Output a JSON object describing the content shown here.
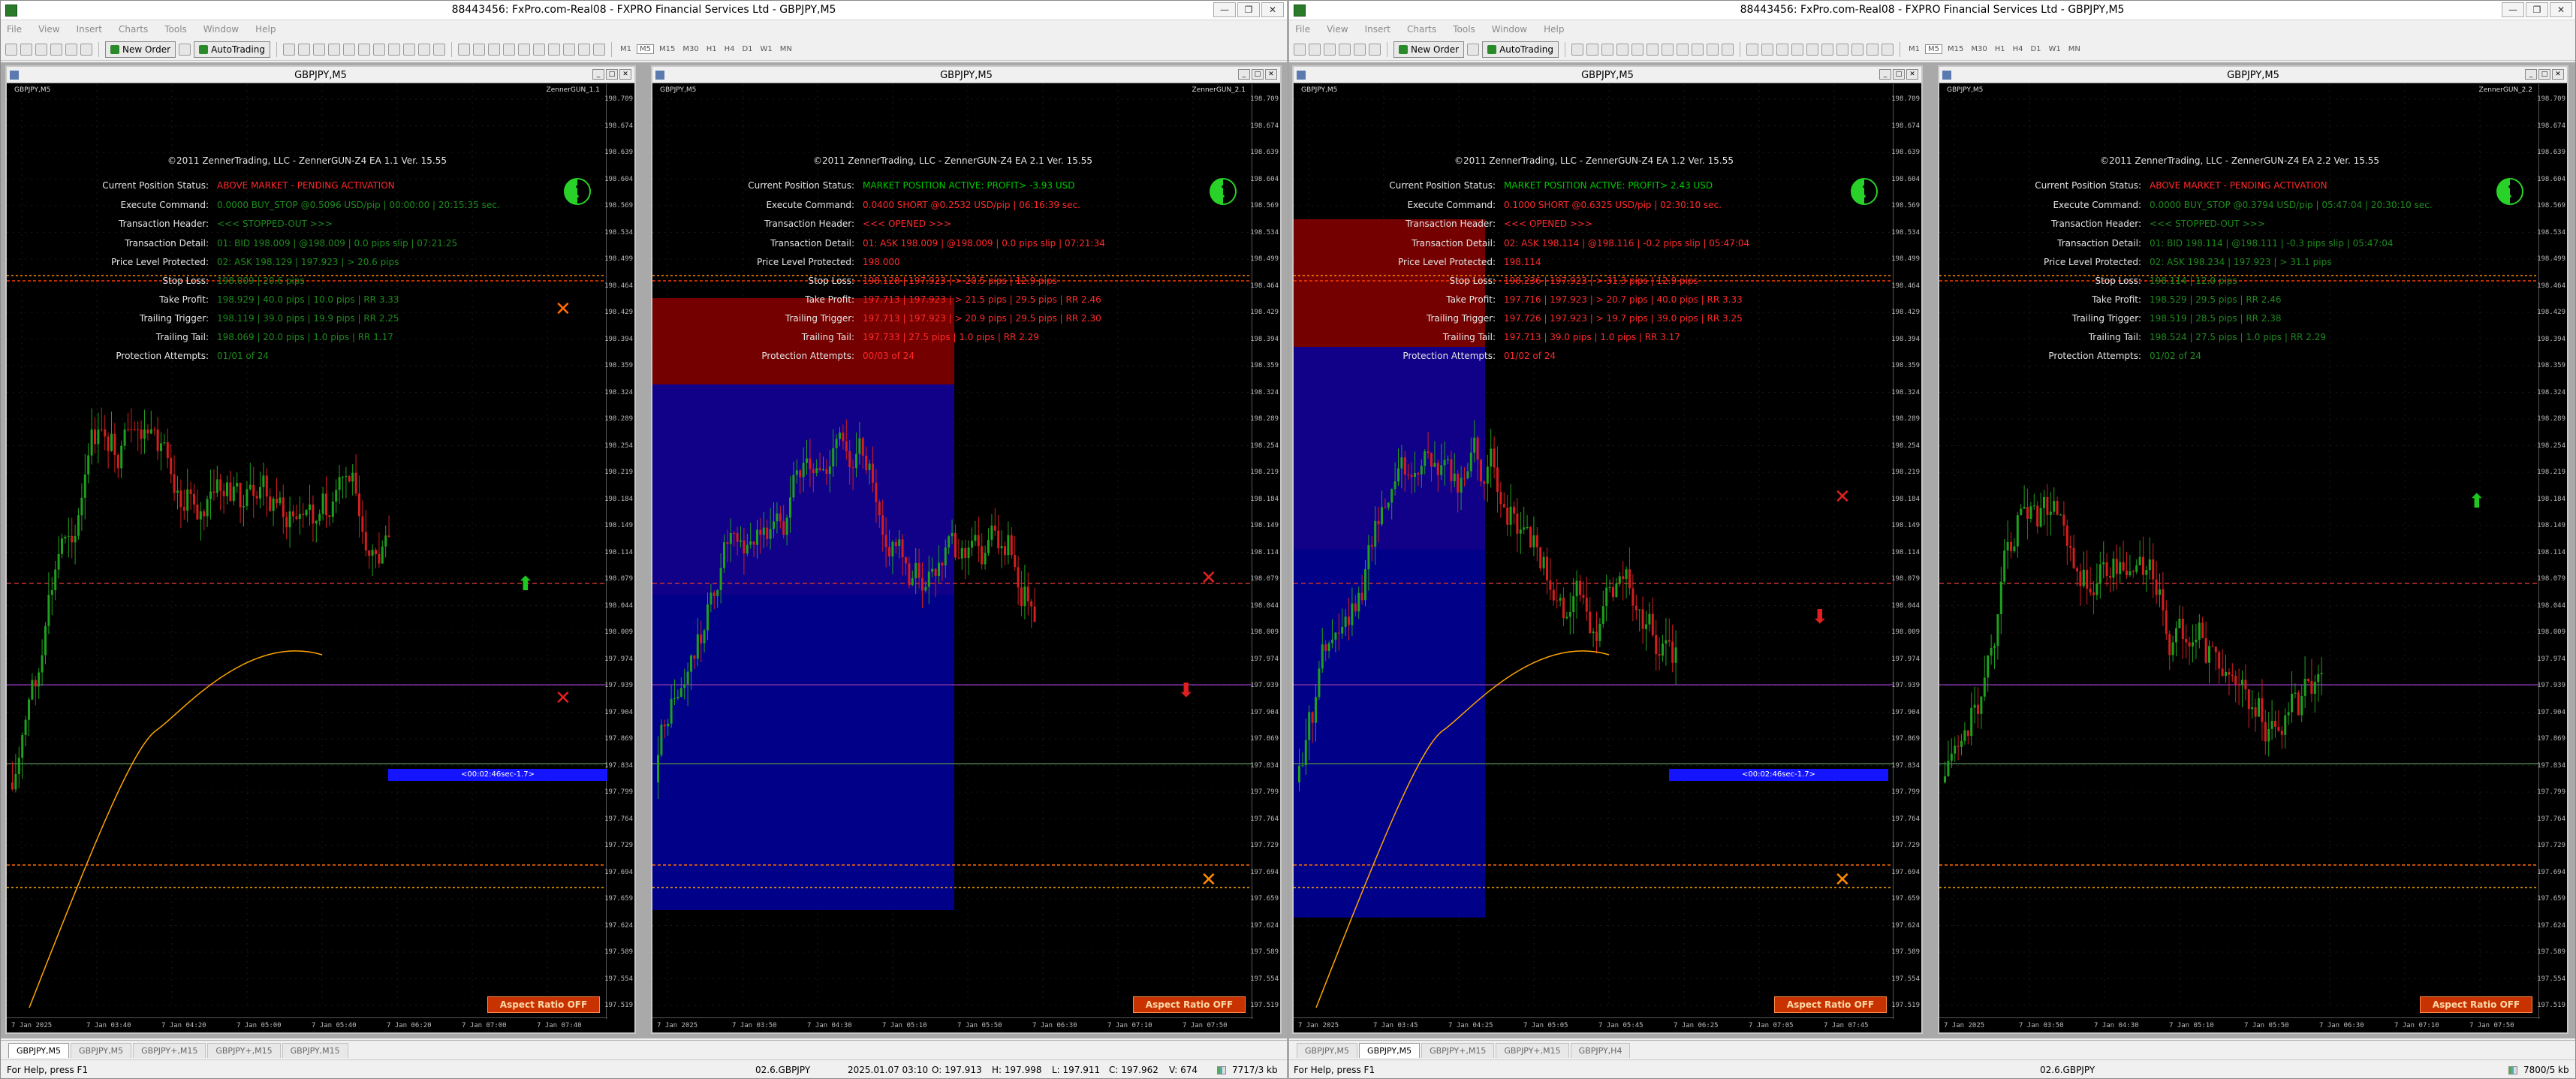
{
  "colors": {
    "label": "#e6e6e6",
    "green": "#00c800",
    "red": "#ff2a2a",
    "darkgreen": "#1e8a1e"
  },
  "windows": [
    {
      "title": "88443456: FxPro.com-Real08 - FXPRO Financial Services Ltd - GBPJPY,M5",
      "menu": [
        "File",
        "View",
        "Insert",
        "Charts",
        "Tools",
        "Window",
        "Help"
      ],
      "toolbar": {
        "new_order": "New Order",
        "auto_trading": "AutoTrading",
        "timeframes": [
          "M1",
          "M5",
          "M15",
          "M30",
          "H1",
          "H4",
          "D1",
          "W1",
          "MN"
        ],
        "active_tf": "M5"
      },
      "tabs": [
        "GBPJPY,M5",
        "GBPJPY,M5",
        "GBPJPY+,M15",
        "GBPJPY+,M15",
        "GBPJPY,M15"
      ],
      "active_tab": 0,
      "status": {
        "help": "For Help, press F1",
        "profile": "02.6.GBPJPY",
        "datetime": "2025.01.07 03:10",
        "open": "O: 197.913",
        "high": "H: 197.998",
        "low": "L: 197.911",
        "close": "C: 197.962",
        "volume": "V: 674",
        "traffic": "7717/3 kb"
      }
    },
    {
      "title": "88443456: FxPro.com-Real08 - FXPRO Financial Services Ltd - GBPJPY,M5",
      "menu": [
        "File",
        "View",
        "Insert",
        "Charts",
        "Tools",
        "Window",
        "Help"
      ],
      "toolbar": {
        "new_order": "New Order",
        "auto_trading": "AutoTrading",
        "timeframes": [
          "M1",
          "M5",
          "M15",
          "M30",
          "H1",
          "H4",
          "D1",
          "W1",
          "MN"
        ],
        "active_tf": "M5"
      },
      "tabs": [
        "GBPJPY,M5",
        "GBPJPY,M5",
        "GBPJPY+,M15",
        "GBPJPY+,M15",
        "GBPJPY,H4"
      ],
      "active_tab": 1,
      "status": {
        "help": "For Help, press F1",
        "profile": "02.6.GBPJPY",
        "traffic": "7800/5 kb"
      }
    }
  ],
  "charts": [
    {
      "title": "GBPJPY,M5",
      "symbol_tag": "GBPJPY,M5",
      "ea_tag": "ZennerGUN_1.1",
      "header": "©2011 ZennerTrading, LLC - ZennerGUN-Z4 EA 1.1 Ver. 15.55",
      "rows": [
        {
          "label": "Current Position Status:",
          "value": "ABOVE MARKET - PENDING ACTIVATION",
          "color": "#ff2a2a"
        },
        {
          "label": "Execute Command:",
          "value": "0.0000 BUY_STOP @0.5096 USD/pip | 00:00:00 | 20:15:35 sec.",
          "color": "#1e8a1e"
        },
        {
          "label": "Transaction Header:",
          "value": "<<< STOPPED-OUT >>>",
          "color": "#1e8a1e"
        },
        {
          "label": "Transaction Detail:",
          "value": "01: BID 198.009 | @198.009 | 0.0 pips slip | 07:21:25",
          "color": "#1e8a1e"
        },
        {
          "label": "Price Level Protected:",
          "value": "02: ASK 198.129 | 197.923 | > 20.6 pips",
          "color": "#1e8a1e"
        },
        {
          "label": "Stop Loss:",
          "value": "198.009 | 20.6 pips",
          "color": "#1e8a1e"
        },
        {
          "label": "Take Profit:",
          "value": "198.929 | 40.0 pips | 10.0 pips | RR 3.33",
          "color": "#1e8a1e"
        },
        {
          "label": "Trailing Trigger:",
          "value": "198.119 | 39.0 pips | 19.9 pips | RR 2.25",
          "color": "#1e8a1e"
        },
        {
          "label": "Trailing Tail:",
          "value": "198.069 | 20.0 pips | 1.0 pips | RR 1.17",
          "color": "#1e8a1e"
        },
        {
          "label": "Protection Attempts:",
          "value": "01/01 of 24",
          "color": "#1e8a1e"
        }
      ],
      "prices": [
        "198.709",
        "198.674",
        "198.639",
        "198.604",
        "198.569",
        "198.534",
        "198.499",
        "198.464",
        "198.429",
        "198.394",
        "198.359",
        "198.324",
        "198.289",
        "198.254",
        "198.219",
        "198.184",
        "198.149",
        "198.114",
        "198.079",
        "198.044",
        "198.009",
        "197.974",
        "197.939",
        "197.904",
        "197.869",
        "197.834",
        "197.799",
        "197.764",
        "197.729",
        "197.694",
        "197.659",
        "197.624",
        "197.589",
        "197.554",
        "197.519"
      ],
      "times": [
        "7 Jan 2025",
        "7 Jan 03:40",
        "7 Jan 04:20",
        "7 Jan 05:00",
        "7 Jan 05:40",
        "7 Jan 06:20",
        "7 Jan 07:00",
        "7 Jan 07:40"
      ],
      "countdown": "<00:02:46sec-1.7>",
      "aspect": "Aspect Ratio OFF"
    },
    {
      "title": "GBPJPY,M5",
      "symbol_tag": "GBPJPY,M5",
      "ea_tag": "ZennerGUN_2.1",
      "header": "©2011 ZennerTrading, LLC - ZennerGUN-Z4 EA 2.1 Ver. 15.55",
      "rows": [
        {
          "label": "Current Position Status:",
          "value": "MARKET POSITION ACTIVE: PROFIT> -3.93 USD",
          "color": "#00c800"
        },
        {
          "label": "Execute Command:",
          "value": "0.0400 SHORT @0.2532 USD/pip | 06:16:39 sec.",
          "color": "#ff2a2a"
        },
        {
          "label": "Transaction Header:",
          "value": "<<< OPENED >>>",
          "color": "#ff2a2a"
        },
        {
          "label": "Transaction Detail:",
          "value": "01: ASK 198.009 | @198.009 | 0.0 pips slip | 07:21:34",
          "color": "#ff2a2a"
        },
        {
          "label": "Price Level Protected:",
          "value": "198.000",
          "color": "#ff2a2a"
        },
        {
          "label": "Stop Loss:",
          "value": "198.128 | 197.923 | > 20.5 pips | 12.9 pips",
          "color": "#ff2a2a"
        },
        {
          "label": "Take Profit:",
          "value": "197.713 | 197.923 | > 21.5 pips | 29.5 pips | RR 2.46",
          "color": "#ff2a2a"
        },
        {
          "label": "Trailing Trigger:",
          "value": "197.713 | 197.923 | > 20.9 pips | 29.5 pips | RR 2.30",
          "color": "#ff2a2a"
        },
        {
          "label": "Trailing Tail:",
          "value": "197.733 | 27.5 pips | 1.0 pips | RR 2.29",
          "color": "#ff2a2a"
        },
        {
          "label": "Protection Attempts:",
          "value": "00/03 of 24",
          "color": "#ff2a2a"
        }
      ],
      "prices": [
        "198.709",
        "198.674",
        "198.639",
        "198.604",
        "198.569",
        "198.534",
        "198.499",
        "198.464",
        "198.429",
        "198.394",
        "198.359",
        "198.324",
        "198.289",
        "198.254",
        "198.219",
        "198.184",
        "198.149",
        "198.114",
        "198.079",
        "198.044",
        "198.009",
        "197.974",
        "197.939",
        "197.904",
        "197.869",
        "197.834",
        "197.799",
        "197.764",
        "197.729",
        "197.694",
        "197.659",
        "197.624",
        "197.589",
        "197.554",
        "197.519"
      ],
      "times": [
        "7 Jan 2025",
        "7 Jan 03:50",
        "7 Jan 04:30",
        "7 Jan 05:10",
        "7 Jan 05:50",
        "7 Jan 06:30",
        "7 Jan 07:10",
        "7 Jan 07:50"
      ],
      "countdown": "",
      "aspect": "Aspect Ratio OFF"
    },
    {
      "title": "GBPJPY,M5",
      "symbol_tag": "GBPJPY,M5",
      "ea_tag": "",
      "header": "©2011 ZennerTrading, LLC - ZennerGUN-Z4 EA 1.2 Ver. 15.55",
      "rows": [
        {
          "label": "Current Position Status:",
          "value": "MARKET POSITION ACTIVE: PROFIT> 2.43 USD",
          "color": "#00c800"
        },
        {
          "label": "Execute Command:",
          "value": "0.1000 SHORT @0.6325 USD/pip | 02:30:10 sec.",
          "color": "#ff2a2a"
        },
        {
          "label": "Transaction Header:",
          "value": "<<< OPENED >>>",
          "color": "#ff2a2a"
        },
        {
          "label": "Transaction Detail:",
          "value": "02: ASK 198.114 | @198.116 | -0.2 pips slip | 05:47:04",
          "color": "#ff2a2a"
        },
        {
          "label": "Price Level Protected:",
          "value": "198.114",
          "color": "#ff2a2a"
        },
        {
          "label": "Stop Loss:",
          "value": "198.236 | 197.923 | > 31.3 pips | 12.9 pips",
          "color": "#ff2a2a"
        },
        {
          "label": "Take Profit:",
          "value": "197.716 | 197.923 | > 20.7 pips | 40.0 pips | RR 3.33",
          "color": "#ff2a2a"
        },
        {
          "label": "Trailing Trigger:",
          "value": "197.726 | 197.923 | > 19.7 pips | 39.0 pips | RR 3.25",
          "color": "#ff2a2a"
        },
        {
          "label": "Trailing Tail:",
          "value": "197.713 | 39.0 pips | 1.0 pips | RR 3.17",
          "color": "#ff2a2a"
        },
        {
          "label": "Protection Attempts:",
          "value": "01/02 of 24",
          "color": "#ff2a2a"
        }
      ],
      "prices": [
        "198.709",
        "198.674",
        "198.639",
        "198.604",
        "198.569",
        "198.534",
        "198.499",
        "198.464",
        "198.429",
        "198.394",
        "198.359",
        "198.324",
        "198.289",
        "198.254",
        "198.219",
        "198.184",
        "198.149",
        "198.114",
        "198.079",
        "198.044",
        "198.009",
        "197.974",
        "197.939",
        "197.904",
        "197.869",
        "197.834",
        "197.799",
        "197.764",
        "197.729",
        "197.694",
        "197.659",
        "197.624",
        "197.589",
        "197.554",
        "197.519"
      ],
      "times": [
        "7 Jan 2025",
        "7 Jan 03:45",
        "7 Jan 04:25",
        "7 Jan 05:05",
        "7 Jan 05:45",
        "7 Jan 06:25",
        "7 Jan 07:05",
        "7 Jan 07:45"
      ],
      "countdown": "<00:02:46sec-1.7>",
      "aspect": "Aspect Ratio OFF"
    },
    {
      "title": "GBPJPY,M5",
      "symbol_tag": "GBPJPY,M5",
      "ea_tag": "ZennerGUN_2.2",
      "header": "©2011 ZennerTrading, LLC - ZennerGUN-Z4 EA 2.2 Ver. 15.55",
      "rows": [
        {
          "label": "Current Position Status:",
          "value": "ABOVE MARKET - PENDING ACTIVATION",
          "color": "#ff2a2a"
        },
        {
          "label": "Execute Command:",
          "value": "0.0000 BUY_STOP @0.3794 USD/pip | 05:47:04 | 20:30:10 sec.",
          "color": "#1e8a1e"
        },
        {
          "label": "Transaction Header:",
          "value": "<<< STOPPED-OUT >>>",
          "color": "#1e8a1e"
        },
        {
          "label": "Transaction Detail:",
          "value": "01: BID 198.114 | @198.111 | -0.3 pips slip | 05:47:04",
          "color": "#1e8a1e"
        },
        {
          "label": "Price Level Protected:",
          "value": "02: ASK 198.234 | 197.923 | > 31.1 pips",
          "color": "#1e8a1e"
        },
        {
          "label": "Stop Loss:",
          "value": "198.114 | 12.0 pips",
          "color": "#1e8a1e"
        },
        {
          "label": "Take Profit:",
          "value": "198.529 | 29.5 pips | RR 2.46",
          "color": "#1e8a1e"
        },
        {
          "label": "Trailing Trigger:",
          "value": "198.519 | 28.5 pips | RR 2.38",
          "color": "#1e8a1e"
        },
        {
          "label": "Trailing Tail:",
          "value": "198.524 | 27.5 pips | 1.0 pips | RR 2.29",
          "color": "#1e8a1e"
        },
        {
          "label": "Protection Attempts:",
          "value": "01/02 of 24",
          "color": "#1e8a1e"
        }
      ],
      "prices": [
        "198.709",
        "198.674",
        "198.639",
        "198.604",
        "198.569",
        "198.534",
        "198.499",
        "198.464",
        "198.429",
        "198.394",
        "198.359",
        "198.324",
        "198.289",
        "198.254",
        "198.219",
        "198.184",
        "198.149",
        "198.114",
        "198.079",
        "198.044",
        "198.009",
        "197.974",
        "197.939",
        "197.904",
        "197.869",
        "197.834",
        "197.799",
        "197.764",
        "197.729",
        "197.694",
        "197.659",
        "197.624",
        "197.589",
        "197.554",
        "197.519"
      ],
      "times": [
        "7 Jan 2025",
        "7 Jan 03:50",
        "7 Jan 04:30",
        "7 Jan 05:10",
        "7 Jan 05:50",
        "7 Jan 06:30",
        "7 Jan 07:10",
        "7 Jan 07:50"
      ],
      "countdown": "",
      "aspect": "Aspect Ratio OFF"
    }
  ]
}
